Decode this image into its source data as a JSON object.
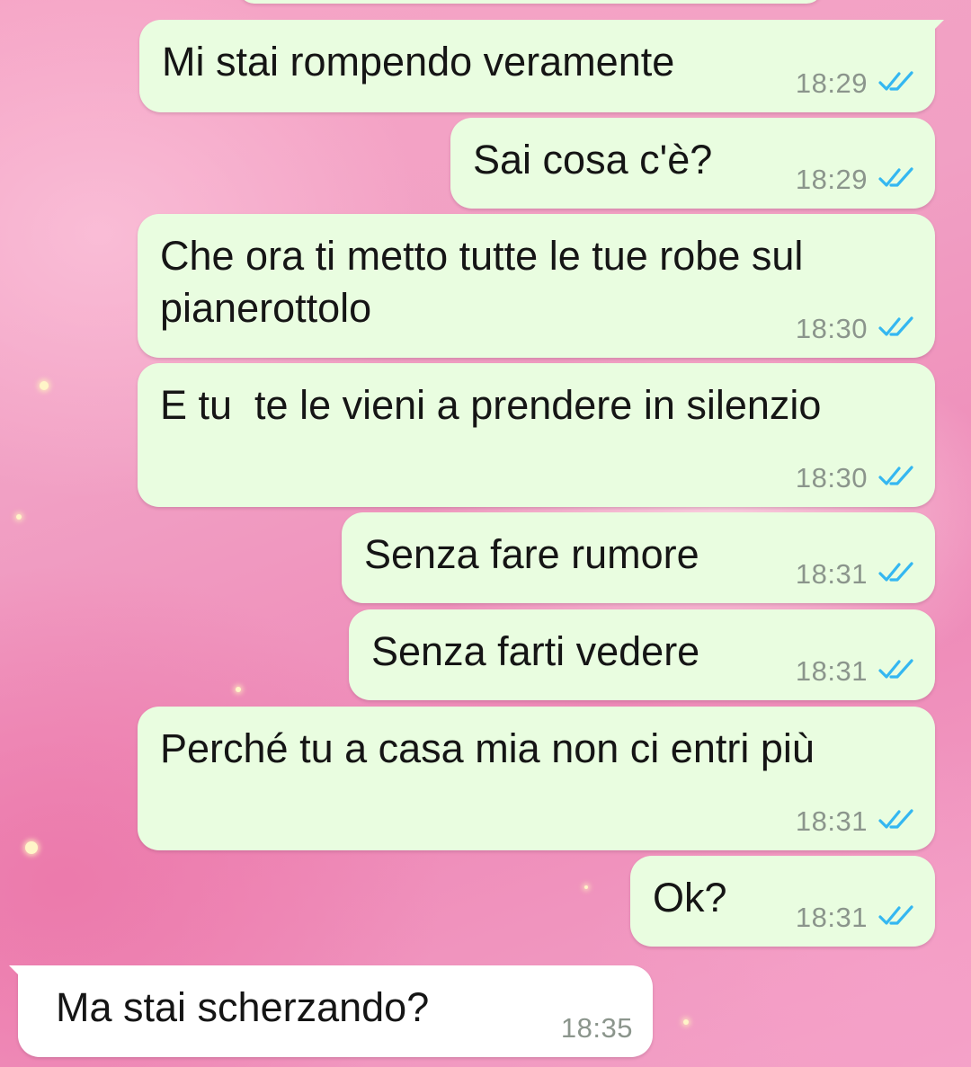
{
  "chat": {
    "messages": [
      {
        "direction": "outgoing",
        "text": "Mi stai rompendo veramente",
        "time": "18:29",
        "status": "read"
      },
      {
        "direction": "outgoing",
        "text": "Sai cosa c'è?",
        "time": "18:29",
        "status": "read"
      },
      {
        "direction": "outgoing",
        "text": "Che ora ti metto tutte le tue robe sul pianerottolo",
        "time": "18:30",
        "status": "read"
      },
      {
        "direction": "outgoing",
        "text": "E tu  te le vieni a prendere in silenzio",
        "time": "18:30",
        "status": "read"
      },
      {
        "direction": "outgoing",
        "text": "Senza fare rumore",
        "time": "18:31",
        "status": "read"
      },
      {
        "direction": "outgoing",
        "text": "Senza farti vedere",
        "time": "18:31",
        "status": "read"
      },
      {
        "direction": "outgoing",
        "text": "Perché tu a casa mia non ci entri più",
        "time": "18:31",
        "status": "read"
      },
      {
        "direction": "outgoing",
        "text": "Ok?",
        "time": "18:31",
        "status": "read"
      },
      {
        "direction": "incoming",
        "text": "Ma stai scherzando?",
        "time": "18:35"
      }
    ]
  },
  "colors": {
    "outgoing_bubble": "#e9fde0",
    "incoming_bubble": "#ffffff",
    "read_ticks": "#34b7f1",
    "timestamp": "#8b958c"
  },
  "icons": {
    "read_status": "double-check-icon"
  }
}
